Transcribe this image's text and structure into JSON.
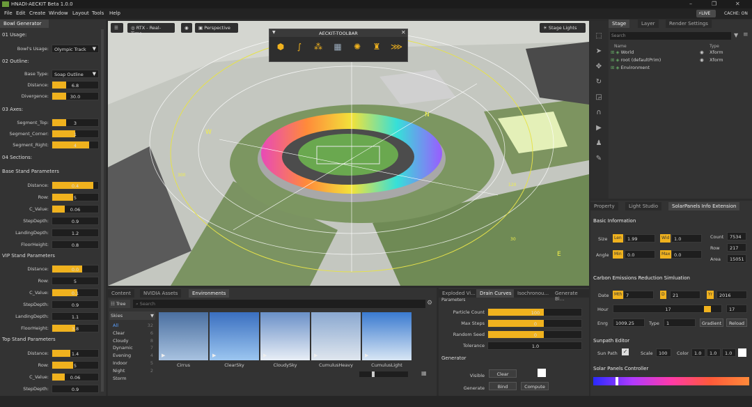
{
  "app": {
    "title": "HNADI-AECKIT Beta 1.0.0",
    "live": "LIVE",
    "cache": "CACHE: ON"
  },
  "menu": [
    "File",
    "Edit",
    "Create",
    "Window",
    "Layout",
    "Tools",
    "Help"
  ],
  "left_panel": {
    "tab": "Bowl Generator",
    "usage": {
      "header": "01 Usage:",
      "label": "Bowl's Usage:",
      "value": "Olympic Track"
    },
    "outline": {
      "header": "02 Outline:",
      "base_label": "Base Type:",
      "base_value": "Soap Outline",
      "fields": [
        {
          "label": "Distance:",
          "value": "6.8",
          "fill": 0.3
        },
        {
          "label": "Divergence:",
          "value": "30.0",
          "fill": 0.3
        }
      ]
    },
    "axes": {
      "header": "03 Axes:",
      "fields": [
        {
          "label": "Segment_Top:",
          "value": "3",
          "fill": 0.3
        },
        {
          "label": "Segment_Corner:",
          "value": "1",
          "fill": 0.5
        },
        {
          "label": "Segment_Right:",
          "value": "4",
          "fill": 0.8
        }
      ]
    },
    "sections_header": "04 Sections:",
    "base": {
      "header": "Base Stand Parameters",
      "fields": [
        {
          "label": "Distance:",
          "value": "0.4",
          "fill": 0.9
        },
        {
          "label": "Row:",
          "value": "5",
          "fill": 0.45
        },
        {
          "label": "C_Value:",
          "value": "0.06",
          "fill": 0.28
        },
        {
          "label": "StepDepth:",
          "value": "0.9",
          "fill": 0
        },
        {
          "label": "LandingDepth:",
          "value": "1.2",
          "fill": 0
        },
        {
          "label": "FloorHeight:",
          "value": "0.8",
          "fill": 0
        }
      ]
    },
    "vip": {
      "header": "VIP Stand Parameters",
      "fields": [
        {
          "label": "Distance:",
          "value": "0.0",
          "fill": 0.65
        },
        {
          "label": "Row:",
          "value": "5",
          "fill": 0
        },
        {
          "label": "C_Value:",
          "value": "0.1",
          "fill": 0.55
        },
        {
          "label": "StepDepth:",
          "value": "0.9",
          "fill": 0
        },
        {
          "label": "LandingDepth:",
          "value": "1.1",
          "fill": 0
        },
        {
          "label": "FloorHeight:",
          "value": "3.8",
          "fill": 0.5
        }
      ]
    },
    "top": {
      "header": "Top Stand Parameters",
      "fields": [
        {
          "label": "Distance:",
          "value": "1.4",
          "fill": 0.4
        },
        {
          "label": "Row:",
          "value": "5",
          "fill": 0.45
        },
        {
          "label": "C_Value:",
          "value": "0.06",
          "fill": 0.28
        },
        {
          "label": "StepDepth:",
          "value": "0.9",
          "fill": 0
        }
      ]
    }
  },
  "viewport": {
    "rtx": "RTX - Real-Time",
    "camera": "Perspective",
    "stage_lights": "Stage Lights",
    "toolbar_title": "AECKIT-TOOLBAR",
    "compass": [
      "N",
      "W",
      "E"
    ],
    "angles": [
      "300",
      "120",
      "30"
    ]
  },
  "stage": {
    "tabs": [
      "Stage",
      "Layer",
      "Render Settings"
    ],
    "search_placeholder": "Search",
    "col_name": "Name",
    "col_type": "Type",
    "rows": [
      {
        "name": "World",
        "type": "Xform"
      },
      {
        "name": "root (defaultPrim)",
        "type": "Xform"
      },
      {
        "name": "Environment",
        "type": ""
      }
    ]
  },
  "props": {
    "tabs": [
      "Property",
      "Light Studio",
      "SolarPanels Info Extension"
    ],
    "basic": {
      "header": "Basic Information",
      "size": "Size",
      "len_tag": "Len",
      "len": "1.99",
      "wid_tag": "Wid",
      "wid": "1.0",
      "angle": "Angle",
      "min_tag": "Min",
      "min": "0.0",
      "max_tag": "Max",
      "max": "0.0",
      "count_label": "Count",
      "count": "7534",
      "row_label": "Row",
      "row": "217",
      "area_label": "Area",
      "area": "15051"
    },
    "carbon": {
      "header": "Carbon Emissions Reduction Simluation",
      "date": "Date",
      "mth_tag": "Mth",
      "mth": "7",
      "d_tag": "D",
      "d": "21",
      "yr_tag": "Yr",
      "yr": "2016",
      "hour": "Hour",
      "hour_val": "17",
      "hour_box": "17",
      "engy": "Enrg",
      "engy_val": "1009.25",
      "type": "Type",
      "type_val": "1",
      "gradient": "Gradient",
      "reload": "Reload"
    },
    "sunpath": {
      "header": "Sunpath Editor",
      "sun_path": "Sun Path",
      "scale": "Scale",
      "scale_val": "100",
      "color": "Color",
      "c1": "1.0",
      "c2": "1.0",
      "c3": "1.0"
    },
    "solar_ctrl": {
      "header": "Solar Panels Controller"
    }
  },
  "content": {
    "tabs": [
      "Content",
      "NVIDIA Assets",
      "Environments"
    ],
    "tree": "Tree",
    "search_placeholder": "Search",
    "skies_label": "Skies",
    "skies": [
      {
        "name": "All",
        "n": "32"
      },
      {
        "name": "Clear",
        "n": "6"
      },
      {
        "name": "Cloudy",
        "n": "8"
      },
      {
        "name": "Dynamic",
        "n": "7"
      },
      {
        "name": "Evening",
        "n": "4"
      },
      {
        "name": "Indoor",
        "n": "5"
      },
      {
        "name": "Night",
        "n": "2"
      },
      {
        "name": "Storm",
        "n": ""
      }
    ],
    "thumbs": [
      "Cirrus",
      "ClearSky",
      "CloudySky",
      "CumulusHeavy",
      "CumulusLight"
    ]
  },
  "drain": {
    "tabs": [
      "Exploded Vi...",
      "Drain Curves",
      "Isochronou...",
      "Generate Bl..."
    ],
    "params_header": "Parameters",
    "fields": [
      {
        "label": "Particle Count",
        "value": "100",
        "fill": 0.6
      },
      {
        "label": "Max Steps",
        "value": "0",
        "fill": 0.6
      },
      {
        "label": "Random Seed",
        "value": "0",
        "fill": 0.6
      },
      {
        "label": "Tolerance",
        "value": "1.0",
        "fill": 0
      }
    ],
    "generator": "Generator",
    "visible": "Visible",
    "clear": "Clear",
    "generate": "Generate",
    "bind": "Bind",
    "compute": "Compute"
  },
  "colors": {
    "accent": "#f0b21e",
    "panel": "#333333"
  }
}
